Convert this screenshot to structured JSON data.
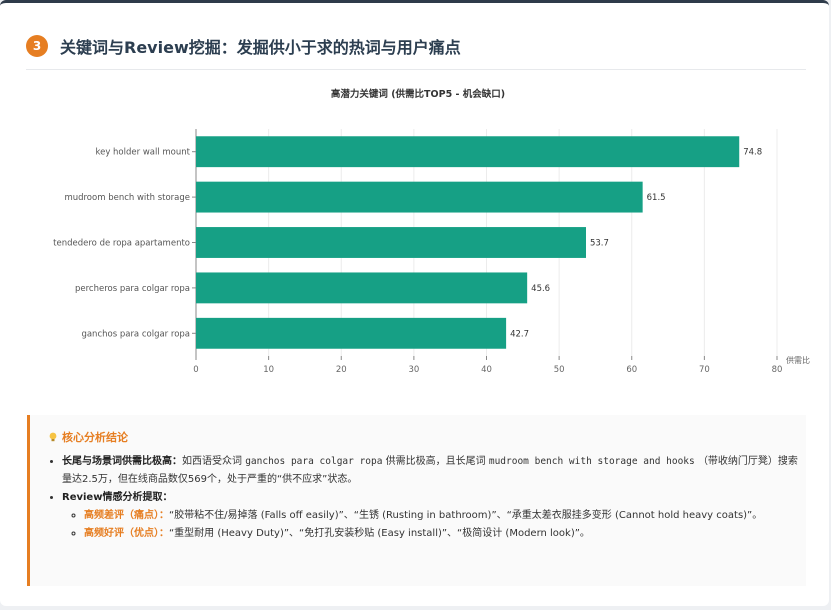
{
  "section": {
    "number": "3",
    "title": "关键词与Review挖掘：发掘供小于求的热词与用户痛点"
  },
  "colors": {
    "bar": "#16a085",
    "accent": "#e67e22",
    "axis": "#888888",
    "grid": "#ececec"
  },
  "chart_data": {
    "type": "bar",
    "orientation": "horizontal",
    "title": "高潜力关键词 (供需比TOP5 - 机会缺口)",
    "xlabel": "供需比",
    "ylabel": "",
    "categories": [
      "key holder wall mount",
      "mudroom bench with storage",
      "tendedero de ropa apartamento",
      "percheros para colgar ropa",
      "ganchos para colgar ropa"
    ],
    "values": [
      74.8,
      61.5,
      53.7,
      45.6,
      42.7
    ],
    "xlim": [
      0,
      80
    ],
    "xticks": [
      0,
      10,
      20,
      30,
      40,
      50,
      60,
      70,
      80
    ],
    "grid": true,
    "legend": "none"
  },
  "conclusion": {
    "heading": "核心分析结论",
    "p1": {
      "label": "长尾与场景词供需比极高：",
      "t1": "如西语受众词",
      "kw1": "ganchos para colgar ropa",
      "t2": "供需比极高，且长尾词",
      "kw2": "mudroom bench with storage and hooks",
      "t3": "（带收纳门厅凳）搜索量达2.5万，但在线商品数仅569个，处于严重的“供不应求”状态。"
    },
    "p2": {
      "label": "Review情感分析提取：",
      "neg_label": "高频差评（痛点）：",
      "neg_text": "“胶带粘不住/易掉落 (Falls off easily)”、“生锈 (Rusting in bathroom)”、“承重太差衣服挂多变形 (Cannot hold heavy coats)”。",
      "pos_label": "高频好评（优点）：",
      "pos_text": "“重型耐用 (Heavy Duty)”、“免打孔安装秒贴 (Easy install)”、“极简设计 (Modern look)”。"
    }
  }
}
